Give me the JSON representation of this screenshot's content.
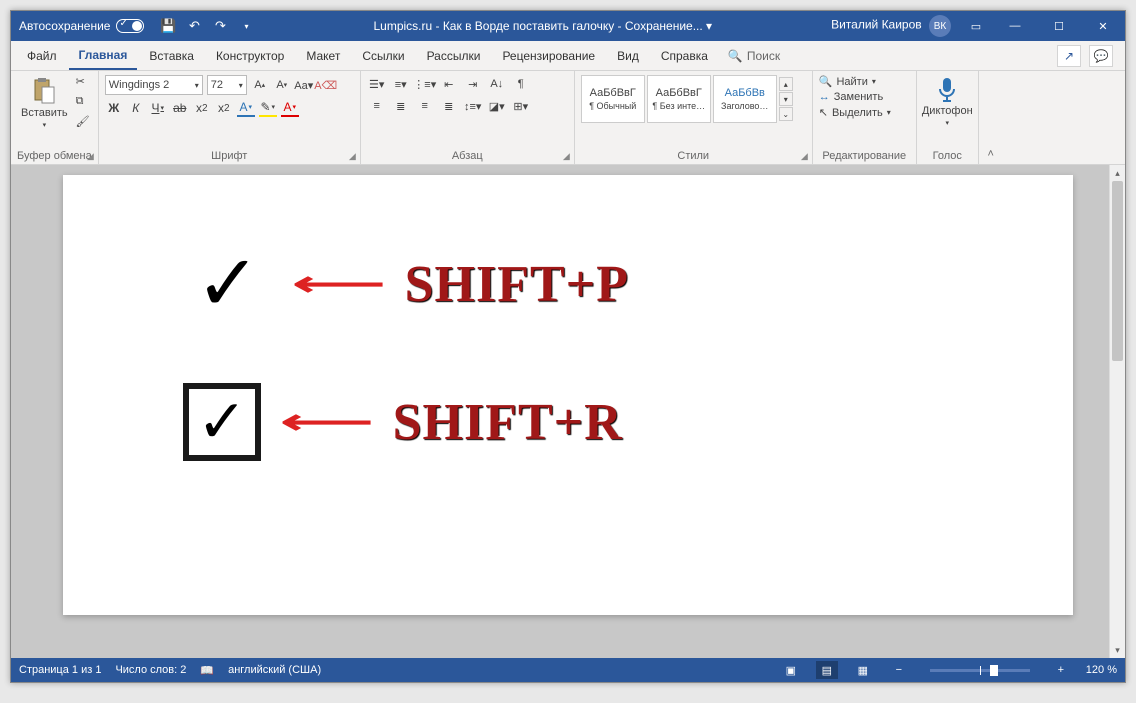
{
  "titlebar": {
    "autosave": "Автосохранение",
    "doc_title": "Lumpics.ru - Как в Ворде поставить галочку - Сохранение... ▾",
    "user": "Виталий Каиров",
    "user_initials": "ВК"
  },
  "tabs": {
    "file": "Файл",
    "home": "Главная",
    "insert": "Вставка",
    "design": "Конструктор",
    "layout": "Макет",
    "references": "Ссылки",
    "mailings": "Рассылки",
    "review": "Рецензирование",
    "view": "Вид",
    "help": "Справка",
    "search": "Поиск"
  },
  "ribbon": {
    "clipboard": {
      "title": "Буфер обмена",
      "paste": "Вставить"
    },
    "font": {
      "title": "Шрифт",
      "name": "Wingdings 2",
      "size": "72",
      "b": "Ж",
      "i": "К",
      "u": "Ч",
      "s": "ab"
    },
    "paragraph": {
      "title": "Абзац"
    },
    "styles": {
      "title": "Стили",
      "sample": "АаБбВвГ",
      "sample_h": "АаБбВв",
      "normal": "¶ Обычный",
      "nospace": "¶ Без инте…",
      "heading1": "Заголово…"
    },
    "editing": {
      "title": "Редактирование",
      "find": "Найти",
      "replace": "Заменить",
      "select": "Выделить"
    },
    "voice": {
      "title": "Голос",
      "dictate": "Диктофон"
    }
  },
  "document": {
    "row1_label": "SHIFT+P",
    "row2_label": "SHIFT+R"
  },
  "statusbar": {
    "page": "Страница 1 из 1",
    "words": "Число слов: 2",
    "lang": "английский (США)",
    "zoom": "120 %"
  }
}
